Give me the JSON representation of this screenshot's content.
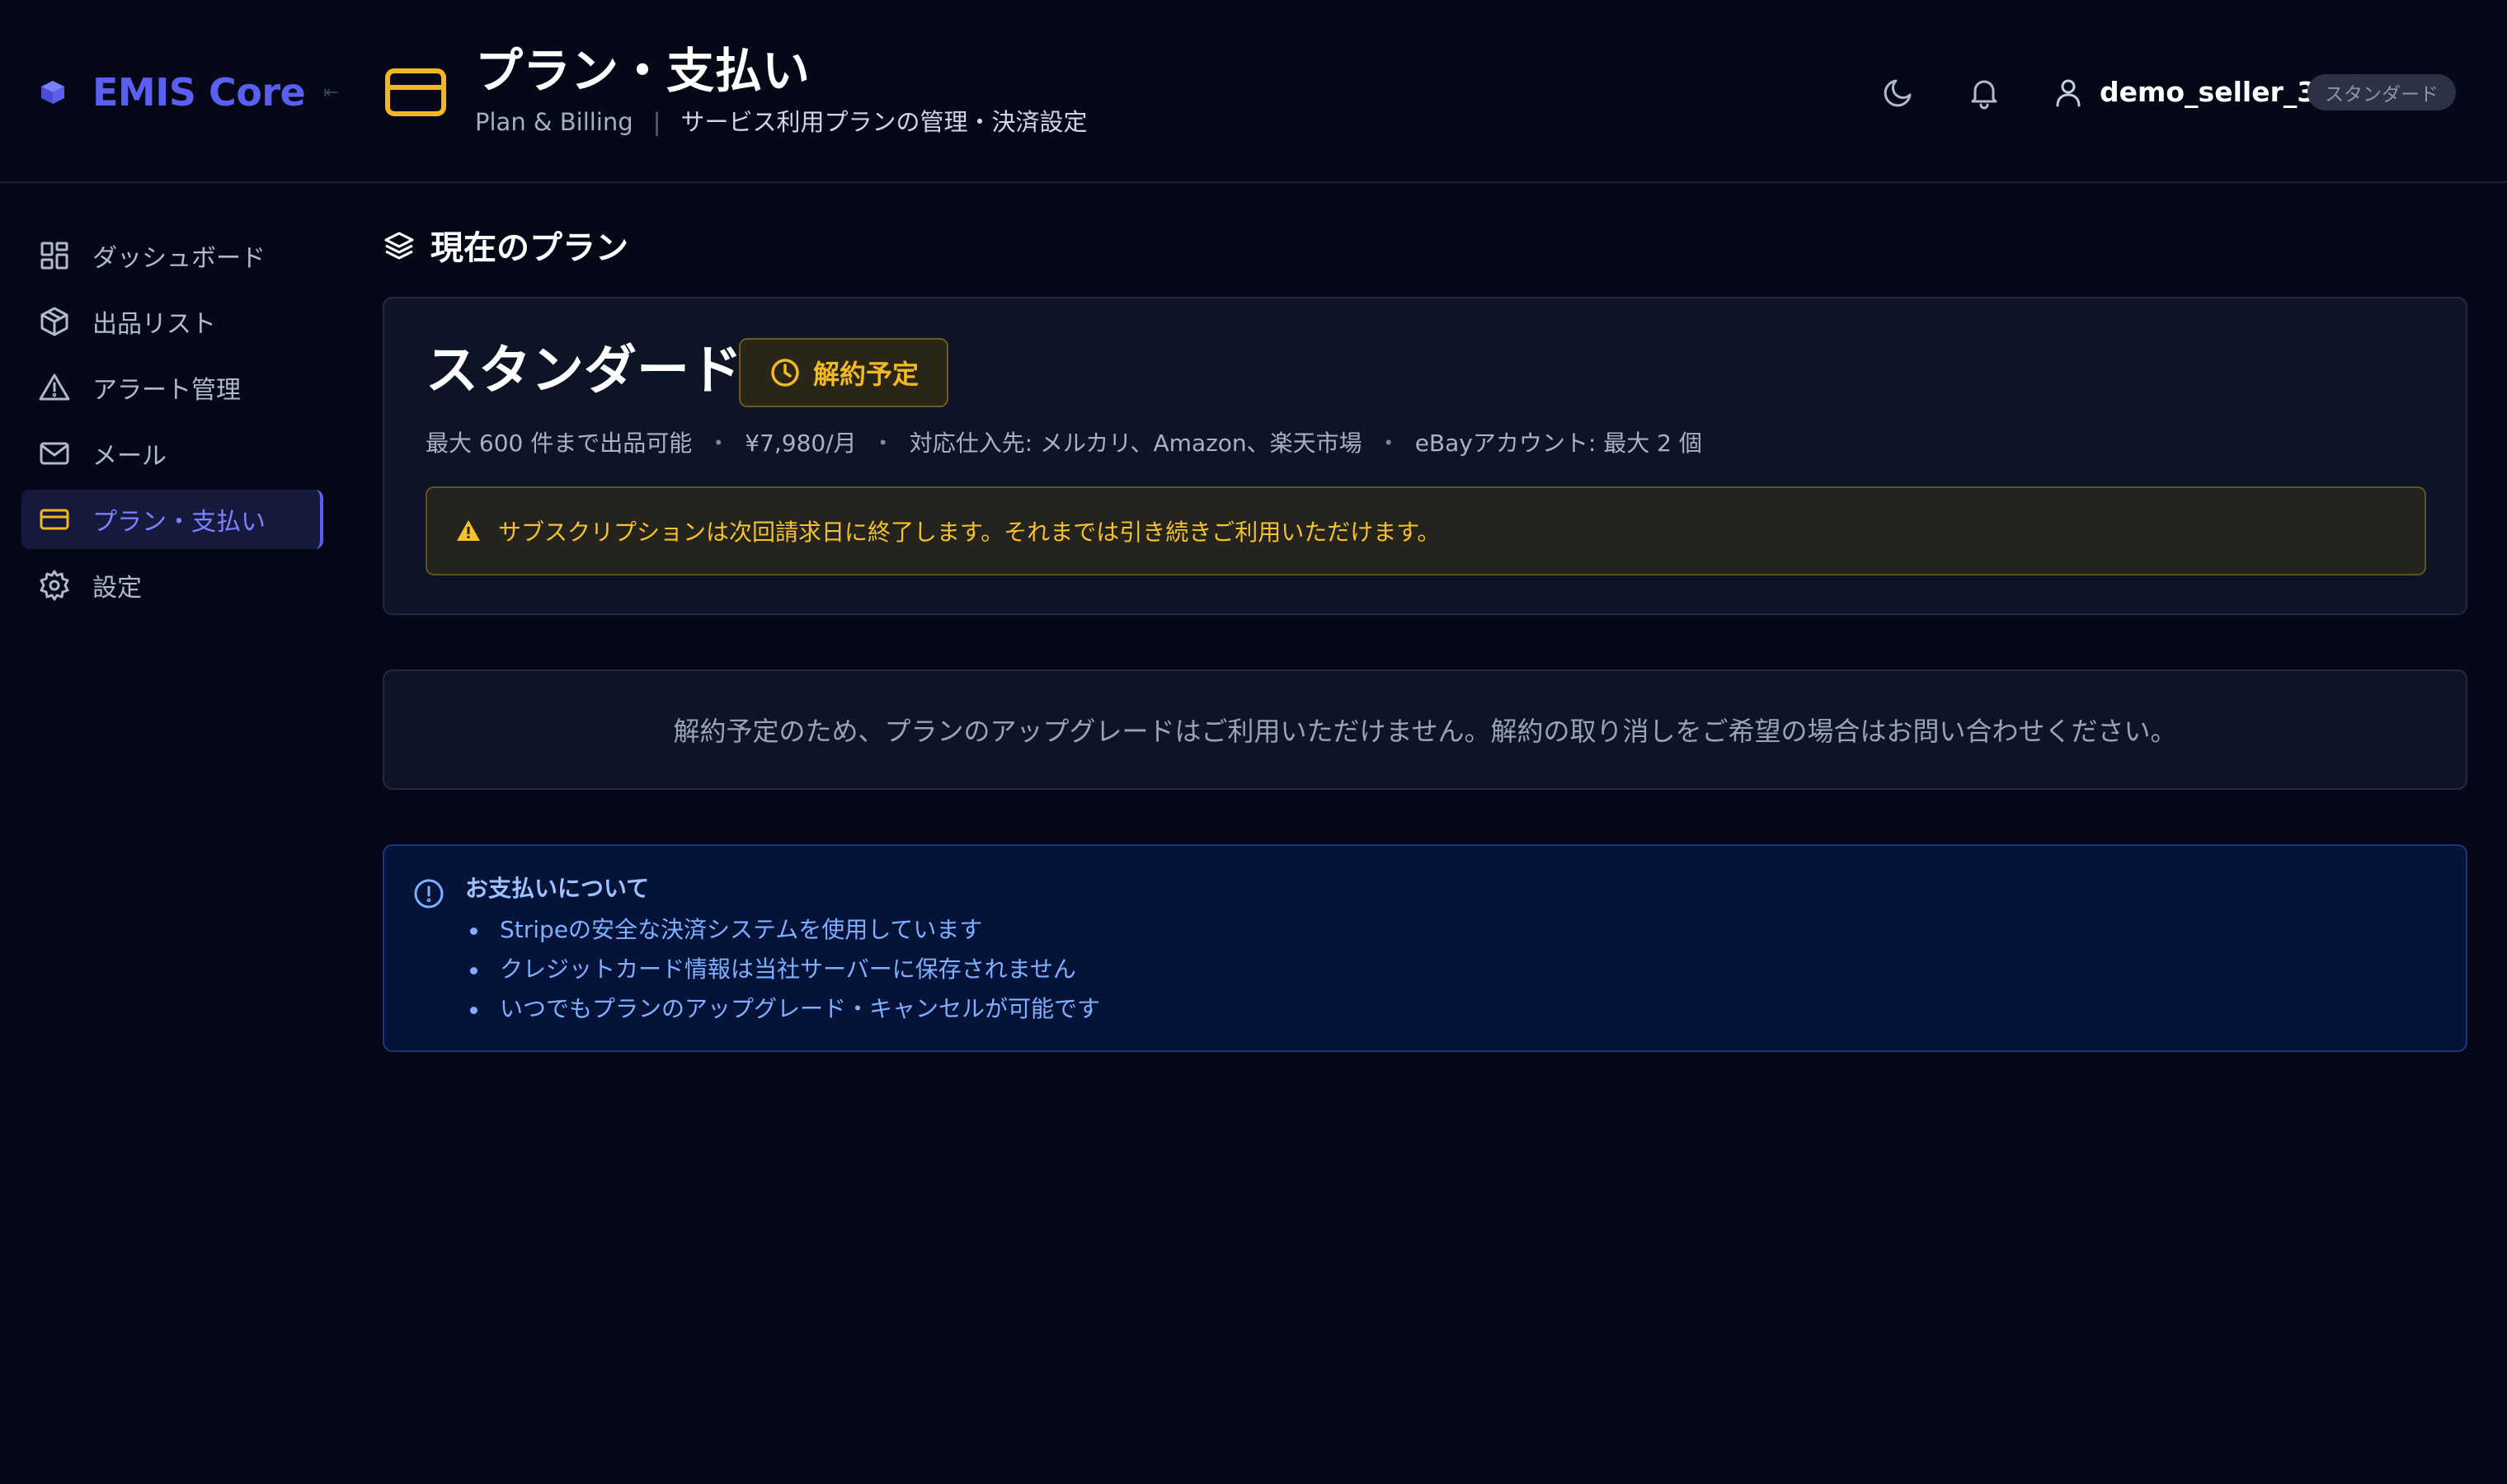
{
  "brand": {
    "name": "EMIS Core",
    "collapse_glyph": "⇤",
    "color": "#5b5ff0"
  },
  "header": {
    "title": "プラン・支払い",
    "subtitle_en": "Plan & Billing",
    "subtitle_sep": "|",
    "subtitle_ja": "サービス利用プランの管理・決済設定",
    "icon": "credit-card-icon",
    "icon_color": "#f2b824"
  },
  "topbar": {
    "theme_icon": "moon-icon",
    "notification_icon": "bell-icon",
    "user_icon": "user-icon",
    "username": "demo_seller_3",
    "plan_badge": "スタンダード"
  },
  "sidebar": {
    "items": [
      {
        "label": "ダッシュボード",
        "icon": "dashboard-icon",
        "active": false
      },
      {
        "label": "出品リスト",
        "icon": "package-icon",
        "active": false
      },
      {
        "label": "アラート管理",
        "icon": "alert-triangle-icon",
        "active": false
      },
      {
        "label": "メール",
        "icon": "mail-icon",
        "active": false
      },
      {
        "label": "プラン・支払い",
        "icon": "credit-card-icon",
        "active": true
      },
      {
        "label": "設定",
        "icon": "gear-icon",
        "active": false
      }
    ],
    "active_color": "#7b80ff"
  },
  "current_plan": {
    "section_title": "現在のプラン",
    "section_icon": "layers-icon",
    "plan_name": "スタンダード",
    "status_badge": "解約予定",
    "status_icon": "clock-icon",
    "meta": [
      "最大 600 件まで出品可能",
      "¥7,980/月",
      "対応仕入先: メルカリ、Amazon、楽天市場",
      "eBayアカウント: 最大 2 個"
    ],
    "meta_sep": "・",
    "warning": "サブスクリプションは次回請求日に終了します。それまでは引き続きご利用いただけます。",
    "warning_icon": "warning-icon",
    "warning_color": "#f2c230"
  },
  "upgrade_notice": "解約予定のため、プランのアップグレードはご利用いただけません。解約の取り消しをご希望の場合はお問い合わせください。",
  "payment_info": {
    "title": "お支払いについて",
    "icon": "info-icon",
    "items": [
      "Stripeの安全な決済システムを使用しています",
      "クレジットカード情報は当社サーバーに保存されません",
      "いつでもプランのアップグレード・キャンセルが可能です"
    ],
    "color": "#7fb0ff"
  }
}
